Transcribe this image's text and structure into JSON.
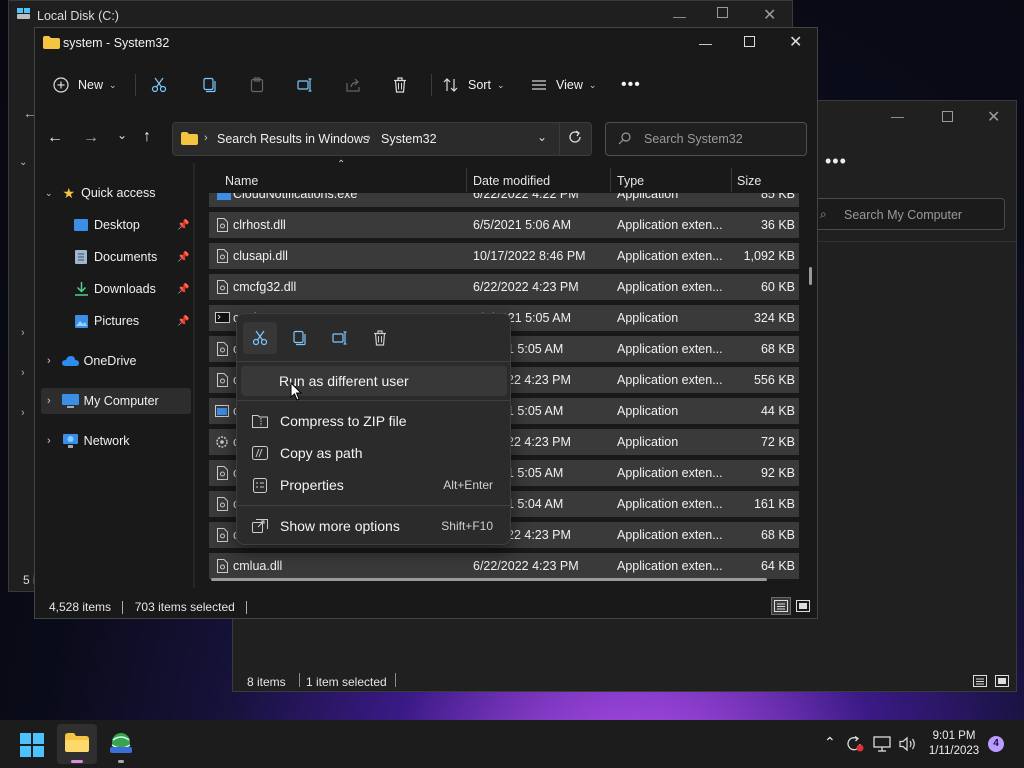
{
  "colors": {
    "accent": "#4cc2ff",
    "folder": "#f5c542",
    "badge": "#b99cff"
  },
  "back_window_1": {
    "title": "Local Disk (C:)",
    "status_count": "5 i"
  },
  "back_window_2": {
    "search_placeholder": "Search My Computer",
    "status_items": "8 items",
    "status_selected": "1 item selected"
  },
  "window": {
    "title": "system - System32",
    "toolbar": {
      "new": "New",
      "sort": "Sort",
      "view": "View"
    },
    "address": {
      "crumb1": "Search Results in Windows",
      "crumb2": "System32"
    },
    "search_placeholder": "Search System32",
    "nav": {
      "quick_access": "Quick access",
      "desktop": "Desktop",
      "documents": "Documents",
      "downloads": "Downloads",
      "pictures": "Pictures",
      "onedrive": "OneDrive",
      "my_computer": "My Computer",
      "network": "Network"
    },
    "columns": {
      "name": "Name",
      "date": "Date modified",
      "type": "Type",
      "size": "Size"
    },
    "rows": [
      {
        "name": "CloudNotifications.exe",
        "date": "6/22/2022 4:22 PM",
        "type": "Application",
        "size": "85 KB"
      },
      {
        "name": "clrhost.dll",
        "date": "6/5/2021 5:06 AM",
        "type": "Application exten...",
        "size": "36 KB"
      },
      {
        "name": "clusapi.dll",
        "date": "10/17/2022 8:46 PM",
        "type": "Application exten...",
        "size": "1,092 KB"
      },
      {
        "name": "cmcfg32.dll",
        "date": "6/22/2022 4:23 PM",
        "type": "Application exten...",
        "size": "60 KB"
      },
      {
        "name": "cmd.exe",
        "date": "6/5/2021 5:05 AM",
        "type": "Application",
        "size": "324 KB"
      },
      {
        "name": "c",
        "date": "1 5:05 AM",
        "type": "Application exten...",
        "size": "68 KB"
      },
      {
        "name": "c",
        "date": "22 4:23 PM",
        "type": "Application exten...",
        "size": "556 KB"
      },
      {
        "name": "c",
        "date": "1 5:05 AM",
        "type": "Application",
        "size": "44 KB"
      },
      {
        "name": "c",
        "date": "22 4:23 PM",
        "type": "Application",
        "size": "72 KB"
      },
      {
        "name": "c",
        "date": "1 5:05 AM",
        "type": "Application exten...",
        "size": "92 KB"
      },
      {
        "name": "c",
        "date": "1 5:04 AM",
        "type": "Application exten...",
        "size": "161 KB"
      },
      {
        "name": "c",
        "date": "22 4:23 PM",
        "type": "Application exten...",
        "size": "68 KB"
      },
      {
        "name": "cmlua.dll",
        "date": "6/22/2022 4:23 PM",
        "type": "Application exten...",
        "size": "64 KB"
      }
    ],
    "status": {
      "items": "4,528 items",
      "selected": "703 items selected"
    }
  },
  "context_menu": {
    "run_as": "Run as different user",
    "compress": "Compress to ZIP file",
    "copy_path": "Copy as path",
    "properties": "Properties",
    "properties_shortcut": "Alt+Enter",
    "more_options": "Show more options",
    "more_options_shortcut": "Shift+F10"
  },
  "taskbar": {
    "time": "9:01 PM",
    "date": "1/11/2023",
    "notifications": "4"
  }
}
